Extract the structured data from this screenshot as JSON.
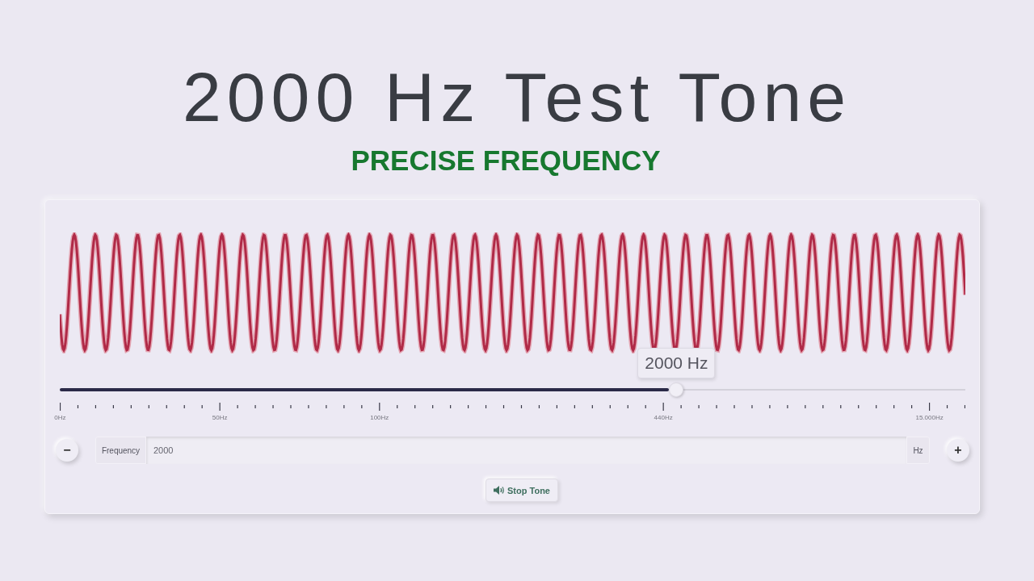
{
  "title": "2000 Hz Test Tone",
  "subtitle": "PRECISE FREQUENCY",
  "slider": {
    "level": 0.681,
    "tooltip": "2000 Hz",
    "scale_labels": [
      "0Hz",
      "50Hz",
      "100Hz",
      "440Hz",
      "15.000Hz"
    ]
  },
  "frequency_input": {
    "decrement": "−",
    "label": "Frequency",
    "value": "2000",
    "unit": "Hz",
    "increment": "+"
  },
  "stop_button": {
    "label": "Stop Tone"
  }
}
